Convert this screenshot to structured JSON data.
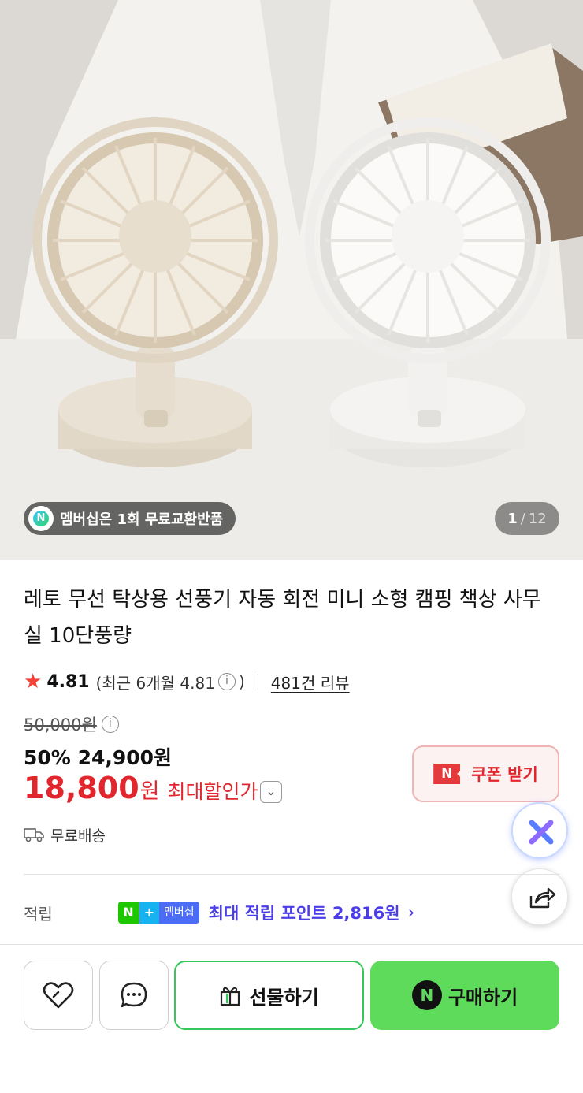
{
  "hero": {
    "image_alt": "two desk fans",
    "membership_badge": "멤버십은 1회 무료교환반품",
    "badge_icon": "N",
    "counter_current": "1",
    "counter_sep": "/",
    "counter_total": "12"
  },
  "product": {
    "title": "레토 무선 탁상용 선풍기 자동 회전 미니 소형 캠핑 책상 사무실 10단풍량",
    "rating": "4.81",
    "rating_recent": "(최근 6개월 4.81",
    "rating_recent_close": ")",
    "review_count": "481건 리뷰",
    "original_price": "50,000원",
    "discount_rate": "50%",
    "discount_price": "24,900원",
    "final_price": "18,800",
    "final_unit": "원",
    "max_discount_label": "최대할인가",
    "shipping": "무료배송"
  },
  "coupon": {
    "icon": "N",
    "label": "쿠폰 받기"
  },
  "points": {
    "label": "적립",
    "badge_n": "N",
    "badge_plus": "+",
    "badge_membership": "멤버십",
    "text": "최대 적립 포인트 2,816원"
  },
  "actions": {
    "gift_label": "선물하기",
    "buy_label": "구매하기",
    "buy_icon": "N"
  },
  "colors": {
    "accent_red": "#e2262d",
    "points_purple": "#4b3ee6",
    "buy_green": "#5edb5a",
    "gift_border": "#34c759"
  },
  "icons": [
    "star-icon",
    "info-icon",
    "chevron-down-icon",
    "truck-icon",
    "ai-assistant-icon",
    "share-icon",
    "heart-icon",
    "chat-icon",
    "gift-icon",
    "chevron-right-icon"
  ]
}
